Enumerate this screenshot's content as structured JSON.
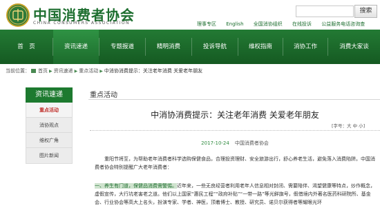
{
  "header": {
    "logo_cn": "中国消费者协会",
    "logo_en": "CHINA CONSUMERS ASSOCIATION",
    "search_button": "搜索",
    "top_links": [
      "理事专区",
      "English",
      "全国消协组织",
      "在线投诉",
      "公益服务电话咨询查"
    ]
  },
  "nav": {
    "items": [
      "首　页",
      "资讯速递",
      "专题报道",
      "精明消费",
      "投诉导航",
      "维权指南",
      "消协工作",
      "消费大家谈"
    ],
    "active_index": 1
  },
  "breadcrumb": {
    "prefix": "当前位置：",
    "items": [
      "首页",
      "资讯速递",
      "重点活动",
      "中消协消费提示：关注老年消费 关爱老年朋友"
    ]
  },
  "sidebar": {
    "title": "资讯速递",
    "items": [
      "重点活动",
      "消协观点",
      "维权广角",
      "图片新闻"
    ],
    "active_index": 0
  },
  "section": {
    "title": "重点活动"
  },
  "article": {
    "title": "中消协消费提示：关注老年消费 关爱老年朋友",
    "fontsize_label": "[字号：大 中 小]",
    "date": "2017-10-24",
    "source": "中国消费者协会",
    "paragraph1": "重阳节将至，为帮助老年消费者科学选购保健食品，合理投资理财、安全旅游出行，舒心养老生活，避免落入消费陷阱。中国消费者协会特别提醒广大老年消费者：",
    "paragraph3_highlight": "一、养生有门道，保健品消费需警惕。",
    "paragraph3_rest": "近年来，一些无良经营者利用老年人信息相对封闭、需要陪伴、渴望健康等特点，炒作概念，虚假宣传，大行坑老害老之道。他们以上国家“惠民工程”“政府补贴”“一带一路”等光鲜旗号，假借境内外著名医药科研院所、基金会、行业协会等高大上名头，扮演专家、学者、神医，顶着博士、教授、研究员、诺贝尔获得者等耀眼光环"
  },
  "colors": {
    "brand_green": "#1d7a2f",
    "active_red": "#c0302b",
    "highlight_bg": "#cfe3ce"
  }
}
